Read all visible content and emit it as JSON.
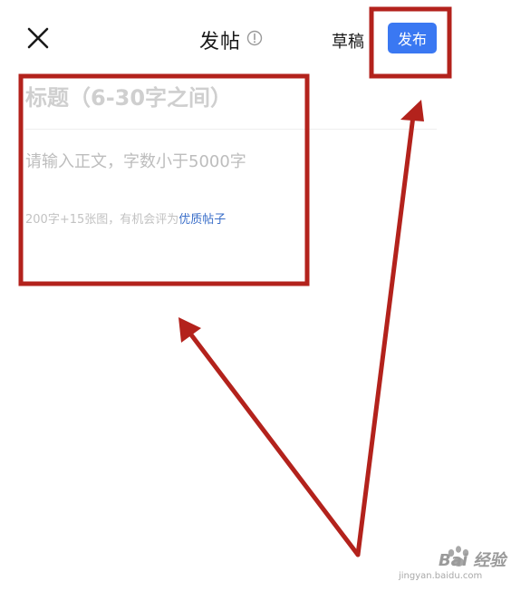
{
  "header": {
    "title": "发帖",
    "draft_label": "草稿",
    "publish_label": "发布"
  },
  "form": {
    "title_placeholder": "标题（6-30字之间）",
    "body_placeholder": "请输入正文，字数小于5000字",
    "hint_prefix": "200字+15张图，有机会评为",
    "hint_link": "优质帖子"
  },
  "watermark": {
    "text": "Bai 经验",
    "url": "jingyan.baidu.com"
  },
  "colors": {
    "accent": "#3a78f2",
    "annotation_red": "#b3221c",
    "link": "#3b6fc9"
  }
}
